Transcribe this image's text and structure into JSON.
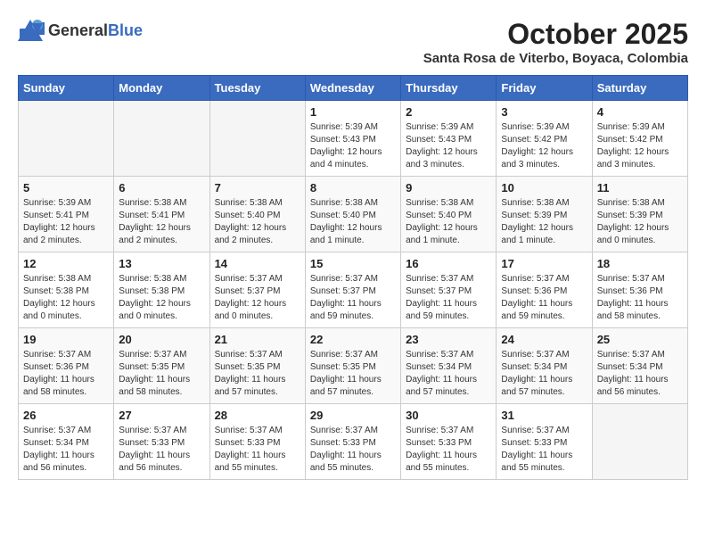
{
  "header": {
    "logo_general": "General",
    "logo_blue": "Blue",
    "month": "October 2025",
    "location": "Santa Rosa de Viterbo, Boyaca, Colombia"
  },
  "weekdays": [
    "Sunday",
    "Monday",
    "Tuesday",
    "Wednesday",
    "Thursday",
    "Friday",
    "Saturday"
  ],
  "weeks": [
    [
      {
        "day": "",
        "info": ""
      },
      {
        "day": "",
        "info": ""
      },
      {
        "day": "",
        "info": ""
      },
      {
        "day": "1",
        "info": "Sunrise: 5:39 AM\nSunset: 5:43 PM\nDaylight: 12 hours\nand 4 minutes."
      },
      {
        "day": "2",
        "info": "Sunrise: 5:39 AM\nSunset: 5:43 PM\nDaylight: 12 hours\nand 3 minutes."
      },
      {
        "day": "3",
        "info": "Sunrise: 5:39 AM\nSunset: 5:42 PM\nDaylight: 12 hours\nand 3 minutes."
      },
      {
        "day": "4",
        "info": "Sunrise: 5:39 AM\nSunset: 5:42 PM\nDaylight: 12 hours\nand 3 minutes."
      }
    ],
    [
      {
        "day": "5",
        "info": "Sunrise: 5:39 AM\nSunset: 5:41 PM\nDaylight: 12 hours\nand 2 minutes."
      },
      {
        "day": "6",
        "info": "Sunrise: 5:38 AM\nSunset: 5:41 PM\nDaylight: 12 hours\nand 2 minutes."
      },
      {
        "day": "7",
        "info": "Sunrise: 5:38 AM\nSunset: 5:40 PM\nDaylight: 12 hours\nand 2 minutes."
      },
      {
        "day": "8",
        "info": "Sunrise: 5:38 AM\nSunset: 5:40 PM\nDaylight: 12 hours\nand 1 minute."
      },
      {
        "day": "9",
        "info": "Sunrise: 5:38 AM\nSunset: 5:40 PM\nDaylight: 12 hours\nand 1 minute."
      },
      {
        "day": "10",
        "info": "Sunrise: 5:38 AM\nSunset: 5:39 PM\nDaylight: 12 hours\nand 1 minute."
      },
      {
        "day": "11",
        "info": "Sunrise: 5:38 AM\nSunset: 5:39 PM\nDaylight: 12 hours\nand 0 minutes."
      }
    ],
    [
      {
        "day": "12",
        "info": "Sunrise: 5:38 AM\nSunset: 5:38 PM\nDaylight: 12 hours\nand 0 minutes."
      },
      {
        "day": "13",
        "info": "Sunrise: 5:38 AM\nSunset: 5:38 PM\nDaylight: 12 hours\nand 0 minutes."
      },
      {
        "day": "14",
        "info": "Sunrise: 5:37 AM\nSunset: 5:37 PM\nDaylight: 12 hours\nand 0 minutes."
      },
      {
        "day": "15",
        "info": "Sunrise: 5:37 AM\nSunset: 5:37 PM\nDaylight: 11 hours\nand 59 minutes."
      },
      {
        "day": "16",
        "info": "Sunrise: 5:37 AM\nSunset: 5:37 PM\nDaylight: 11 hours\nand 59 minutes."
      },
      {
        "day": "17",
        "info": "Sunrise: 5:37 AM\nSunset: 5:36 PM\nDaylight: 11 hours\nand 59 minutes."
      },
      {
        "day": "18",
        "info": "Sunrise: 5:37 AM\nSunset: 5:36 PM\nDaylight: 11 hours\nand 58 minutes."
      }
    ],
    [
      {
        "day": "19",
        "info": "Sunrise: 5:37 AM\nSunset: 5:36 PM\nDaylight: 11 hours\nand 58 minutes."
      },
      {
        "day": "20",
        "info": "Sunrise: 5:37 AM\nSunset: 5:35 PM\nDaylight: 11 hours\nand 58 minutes."
      },
      {
        "day": "21",
        "info": "Sunrise: 5:37 AM\nSunset: 5:35 PM\nDaylight: 11 hours\nand 57 minutes."
      },
      {
        "day": "22",
        "info": "Sunrise: 5:37 AM\nSunset: 5:35 PM\nDaylight: 11 hours\nand 57 minutes."
      },
      {
        "day": "23",
        "info": "Sunrise: 5:37 AM\nSunset: 5:34 PM\nDaylight: 11 hours\nand 57 minutes."
      },
      {
        "day": "24",
        "info": "Sunrise: 5:37 AM\nSunset: 5:34 PM\nDaylight: 11 hours\nand 57 minutes."
      },
      {
        "day": "25",
        "info": "Sunrise: 5:37 AM\nSunset: 5:34 PM\nDaylight: 11 hours\nand 56 minutes."
      }
    ],
    [
      {
        "day": "26",
        "info": "Sunrise: 5:37 AM\nSunset: 5:34 PM\nDaylight: 11 hours\nand 56 minutes."
      },
      {
        "day": "27",
        "info": "Sunrise: 5:37 AM\nSunset: 5:33 PM\nDaylight: 11 hours\nand 56 minutes."
      },
      {
        "day": "28",
        "info": "Sunrise: 5:37 AM\nSunset: 5:33 PM\nDaylight: 11 hours\nand 55 minutes."
      },
      {
        "day": "29",
        "info": "Sunrise: 5:37 AM\nSunset: 5:33 PM\nDaylight: 11 hours\nand 55 minutes."
      },
      {
        "day": "30",
        "info": "Sunrise: 5:37 AM\nSunset: 5:33 PM\nDaylight: 11 hours\nand 55 minutes."
      },
      {
        "day": "31",
        "info": "Sunrise: 5:37 AM\nSunset: 5:33 PM\nDaylight: 11 hours\nand 55 minutes."
      },
      {
        "day": "",
        "info": ""
      }
    ]
  ]
}
